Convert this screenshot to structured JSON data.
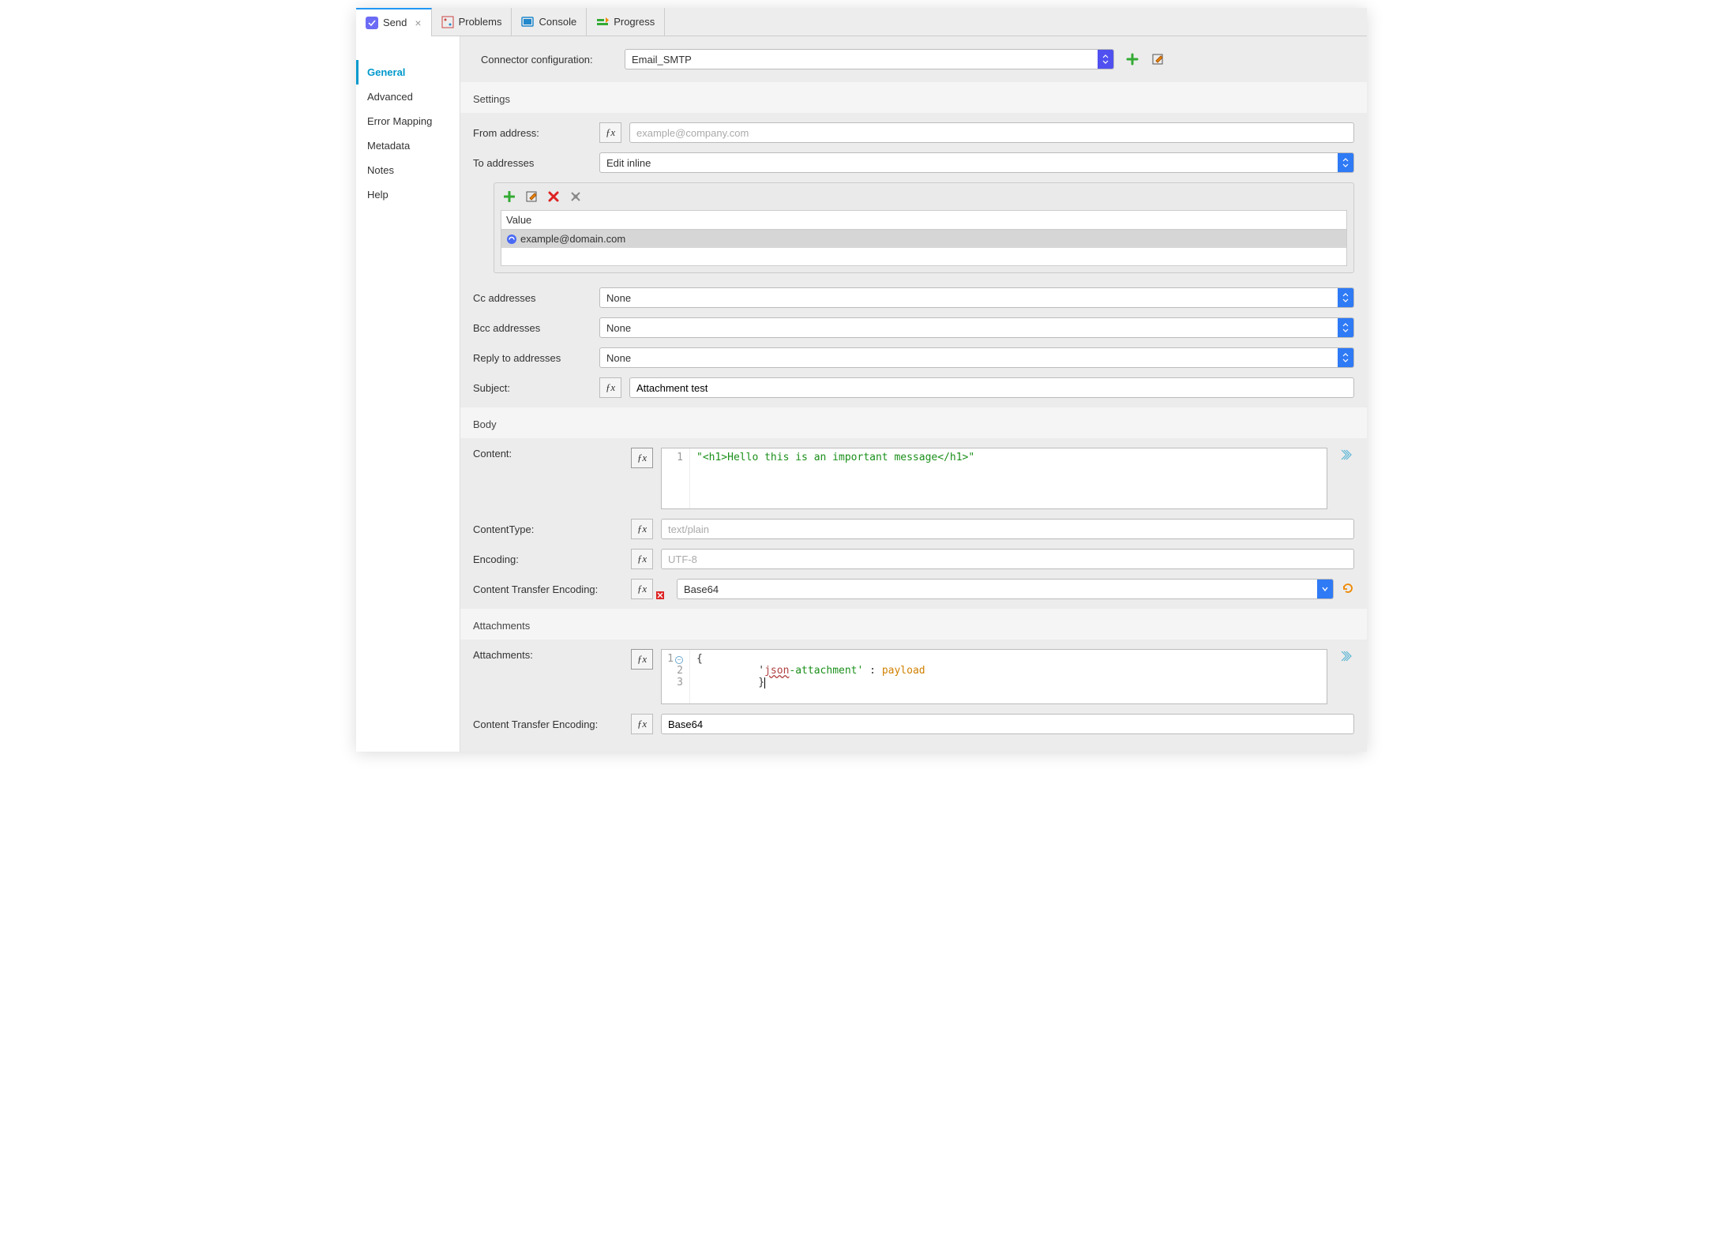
{
  "tabs": [
    {
      "label": "Send",
      "active": true,
      "closeable": true,
      "icon": "send-icon"
    },
    {
      "label": "Problems",
      "active": false,
      "closeable": false,
      "icon": "problems-icon"
    },
    {
      "label": "Console",
      "active": false,
      "closeable": false,
      "icon": "console-icon"
    },
    {
      "label": "Progress",
      "active": false,
      "closeable": false,
      "icon": "progress-icon"
    }
  ],
  "sidebar": {
    "items": [
      "General",
      "Advanced",
      "Error Mapping",
      "Metadata",
      "Notes",
      "Help"
    ],
    "active_index": 0
  },
  "connector": {
    "label": "Connector configuration:",
    "value": "Email_SMTP"
  },
  "settings": {
    "header": "Settings",
    "from_label": "From address:",
    "from_placeholder": "example@company.com",
    "from_value": "",
    "to_label": "To addresses",
    "to_mode": "Edit inline",
    "to_table_header": "Value",
    "to_values": [
      "example@domain.com"
    ],
    "cc_label": "Cc addresses",
    "cc_value": "None",
    "bcc_label": "Bcc addresses",
    "bcc_value": "None",
    "reply_label": "Reply to addresses",
    "reply_value": "None",
    "subject_label": "Subject:",
    "subject_value": "Attachment test"
  },
  "body": {
    "header": "Body",
    "content_label": "Content:",
    "content_code": "\"<h1>Hello this is an important message</h1>\"",
    "content_line": "1",
    "content_type_label": "ContentType:",
    "content_type_placeholder": "text/plain",
    "content_type_value": "",
    "encoding_label": "Encoding:",
    "encoding_placeholder": "UTF-8",
    "encoding_value": "",
    "cte_label": "Content Transfer Encoding:",
    "cte_value": "Base64"
  },
  "attachments": {
    "header": "Attachments",
    "label": "Attachments:",
    "code_lines": [
      "1",
      "2",
      "3"
    ],
    "code_l1_brace": "{",
    "code_l2_pre": "          '",
    "code_l2_red": "json",
    "code_l2_green": "-attachment'",
    "code_l2_sep": " : ",
    "code_l2_ident": "payload",
    "code_l3_brace": "          }",
    "cte_label": "Content Transfer Encoding:",
    "cte_value": "Base64"
  }
}
